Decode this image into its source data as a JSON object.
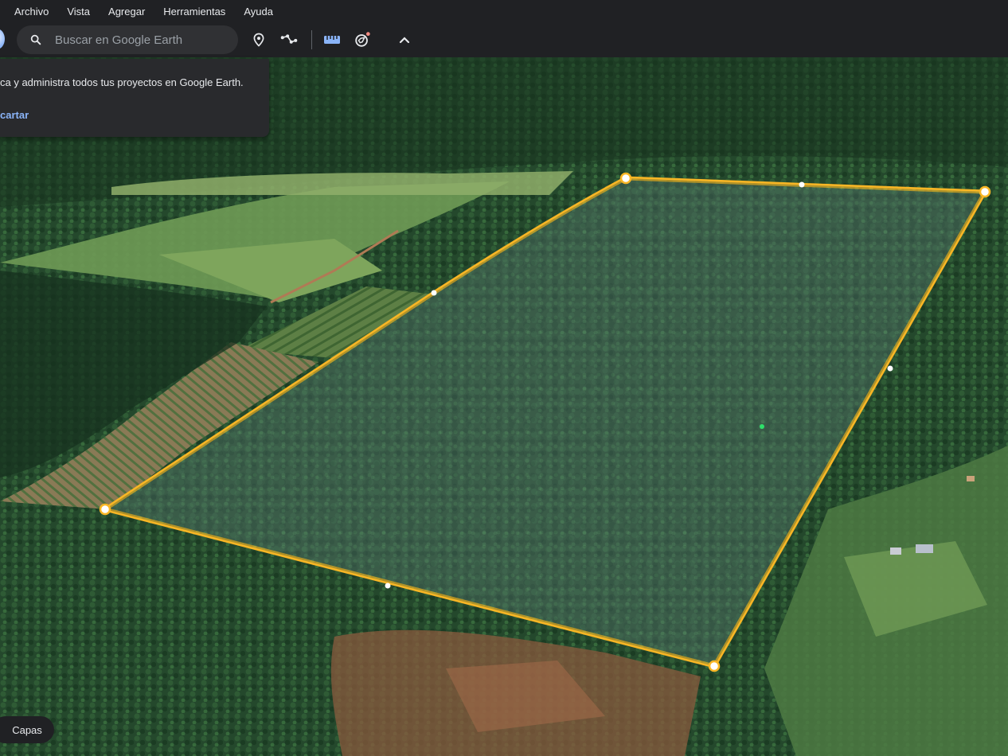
{
  "menu": {
    "items": [
      "Archivo",
      "Vista",
      "Agregar",
      "Herramientas",
      "Ayuda"
    ]
  },
  "toolbar": {
    "search_placeholder": "Buscar en Google Earth",
    "icons": [
      "search-icon",
      "location-pin-icon",
      "path-icon",
      "ruler-icon",
      "voyager-icon",
      "chevron-up-icon"
    ]
  },
  "popup": {
    "message": "ca y administra todos tus proyectos en Google Earth.",
    "dismiss_label": "cartar"
  },
  "layers": {
    "label": "Capas"
  },
  "colors": {
    "polygon_stroke": "#f9b625",
    "polygon_fill": "#8ea3c2",
    "link": "#8ab4f8",
    "ruler_icon": "#8ab4f8",
    "notification_dot": "#f28b82"
  }
}
